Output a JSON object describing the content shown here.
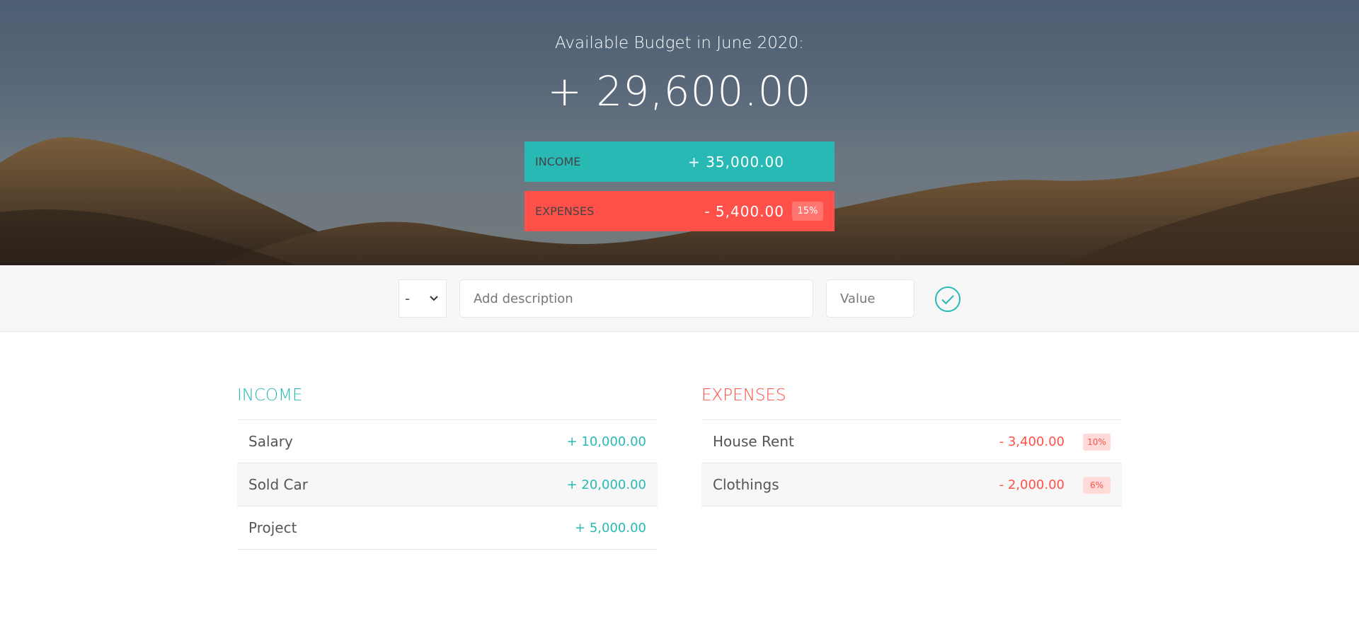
{
  "header": {
    "title": "Available Budget in June 2020:",
    "budget": "+ 29,600.00",
    "income": {
      "label": "Income",
      "value": "+ 35,000.00"
    },
    "expenses": {
      "label": "Expenses",
      "value": "- 5,400.00",
      "percentage": "15%"
    }
  },
  "add": {
    "type_selected": "-",
    "description_placeholder": "Add description",
    "value_placeholder": "Value",
    "submit_icon": "check-circle-icon"
  },
  "income_list": {
    "title": "Income",
    "items": [
      {
        "description": "Salary",
        "value": "+ 10,000.00"
      },
      {
        "description": "Sold Car",
        "value": "+ 20,000.00"
      },
      {
        "description": "Project",
        "value": "+ 5,000.00"
      }
    ]
  },
  "expenses_list": {
    "title": "Expenses",
    "items": [
      {
        "description": "House Rent",
        "value": "- 3,400.00",
        "percentage": "10%"
      },
      {
        "description": "Clothings",
        "value": "- 2,000.00",
        "percentage": "6%"
      }
    ]
  },
  "colors": {
    "income_accent": "#28b9b5",
    "expense_accent": "#ff5049",
    "sky": "#4d5e72",
    "hills": "#5a4530"
  }
}
